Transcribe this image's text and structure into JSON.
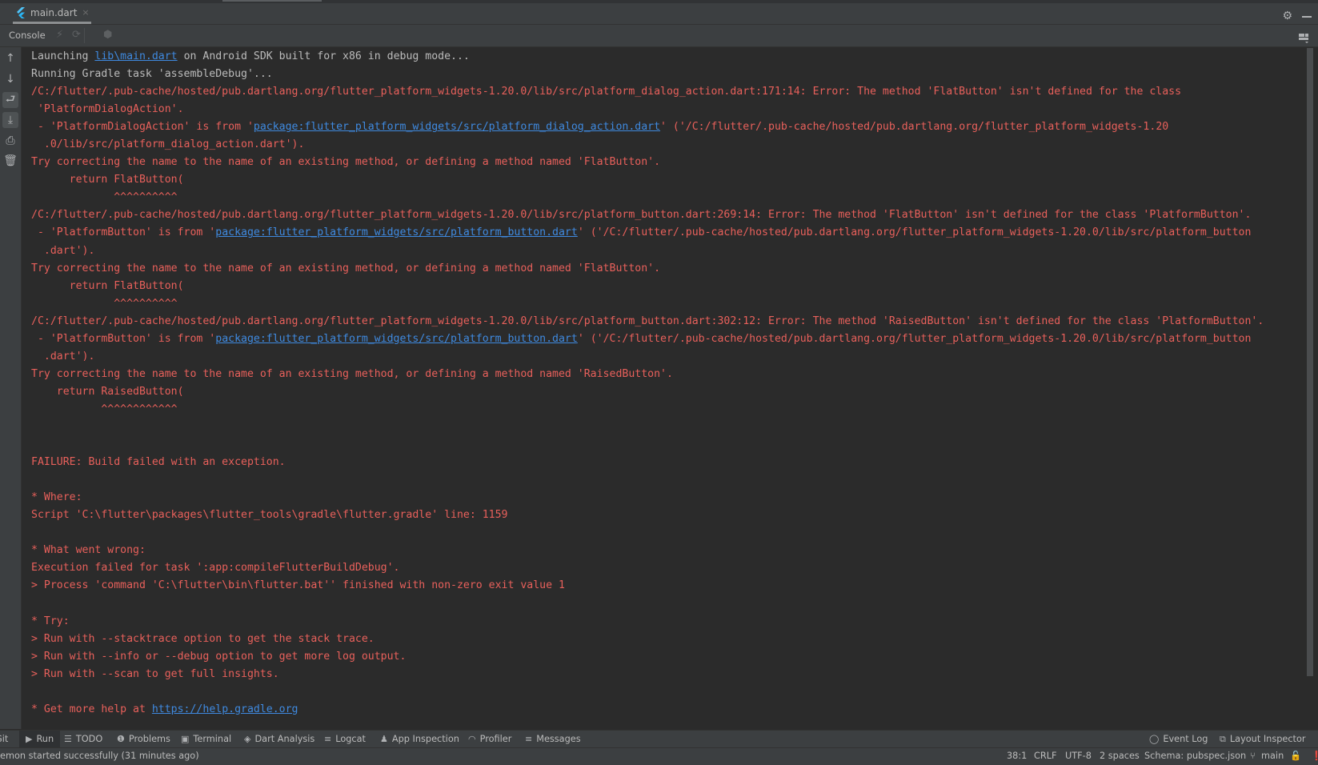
{
  "editor_tab": {
    "label": "main.dart",
    "close": "×",
    "icon": "flutter-icon"
  },
  "toolbar": {
    "console_label": "Console"
  },
  "console": {
    "colors": {
      "info": "#bbbbbb",
      "error": "#e8605b",
      "link": "#3f8ae0"
    },
    "lines": [
      {
        "type": "info",
        "segments": [
          {
            "text": "Launching "
          },
          {
            "text": "lib\\main.dart",
            "link": true
          },
          {
            "text": " on Android SDK built for x86 in debug mode..."
          }
        ]
      },
      {
        "type": "info",
        "segments": [
          {
            "text": "Running Gradle task 'assembleDebug'..."
          }
        ]
      },
      {
        "type": "error",
        "segments": [
          {
            "text": "/C:/flutter/.pub-cache/hosted/pub.dartlang.org/flutter_platform_widgets-1.20.0/lib/src/platform_dialog_action.dart:171:14: Error: The method 'FlatButton' isn't defined for the class"
          }
        ]
      },
      {
        "type": "error",
        "segments": [
          {
            "text": " 'PlatformDialogAction'."
          }
        ]
      },
      {
        "type": "error",
        "segments": [
          {
            "text": " - 'PlatformDialogAction' is from '"
          },
          {
            "text": "package:flutter_platform_widgets/src/platform_dialog_action.dart",
            "link": true
          },
          {
            "text": "' ('/C:/flutter/.pub-cache/hosted/pub.dartlang.org/flutter_platform_widgets-1.20"
          }
        ]
      },
      {
        "type": "error",
        "segments": [
          {
            "text": "  .0/lib/src/platform_dialog_action.dart')."
          }
        ]
      },
      {
        "type": "error",
        "segments": [
          {
            "text": "Try correcting the name to the name of an existing method, or defining a method named 'FlatButton'."
          }
        ]
      },
      {
        "type": "error",
        "segments": [
          {
            "text": "      return FlatButton("
          }
        ]
      },
      {
        "type": "error",
        "segments": [
          {
            "text": "             ^^^^^^^^^^"
          }
        ]
      },
      {
        "type": "error",
        "segments": [
          {
            "text": "/C:/flutter/.pub-cache/hosted/pub.dartlang.org/flutter_platform_widgets-1.20.0/lib/src/platform_button.dart:269:14: Error: The method 'FlatButton' isn't defined for the class 'PlatformButton'."
          }
        ]
      },
      {
        "type": "error",
        "segments": [
          {
            "text": " - 'PlatformButton' is from '"
          },
          {
            "text": "package:flutter_platform_widgets/src/platform_button.dart",
            "link": true
          },
          {
            "text": "' ('/C:/flutter/.pub-cache/hosted/pub.dartlang.org/flutter_platform_widgets-1.20.0/lib/src/platform_button"
          }
        ]
      },
      {
        "type": "error",
        "segments": [
          {
            "text": "  .dart')."
          }
        ]
      },
      {
        "type": "error",
        "segments": [
          {
            "text": "Try correcting the name to the name of an existing method, or defining a method named 'FlatButton'."
          }
        ]
      },
      {
        "type": "error",
        "segments": [
          {
            "text": "      return FlatButton("
          }
        ]
      },
      {
        "type": "error",
        "segments": [
          {
            "text": "             ^^^^^^^^^^"
          }
        ]
      },
      {
        "type": "error",
        "segments": [
          {
            "text": "/C:/flutter/.pub-cache/hosted/pub.dartlang.org/flutter_platform_widgets-1.20.0/lib/src/platform_button.dart:302:12: Error: The method 'RaisedButton' isn't defined for the class 'PlatformButton'."
          }
        ]
      },
      {
        "type": "error",
        "segments": [
          {
            "text": " - 'PlatformButton' is from '"
          },
          {
            "text": "package:flutter_platform_widgets/src/platform_button.dart",
            "link": true
          },
          {
            "text": "' ('/C:/flutter/.pub-cache/hosted/pub.dartlang.org/flutter_platform_widgets-1.20.0/lib/src/platform_button"
          }
        ]
      },
      {
        "type": "error",
        "segments": [
          {
            "text": "  .dart')."
          }
        ]
      },
      {
        "type": "error",
        "segments": [
          {
            "text": "Try correcting the name to the name of an existing method, or defining a method named 'RaisedButton'."
          }
        ]
      },
      {
        "type": "error",
        "segments": [
          {
            "text": "    return RaisedButton("
          }
        ]
      },
      {
        "type": "error",
        "segments": [
          {
            "text": "           ^^^^^^^^^^^^"
          }
        ]
      },
      {
        "type": "error",
        "segments": [
          {
            "text": ""
          }
        ]
      },
      {
        "type": "error",
        "segments": [
          {
            "text": ""
          }
        ]
      },
      {
        "type": "error",
        "segments": [
          {
            "text": "FAILURE: Build failed with an exception."
          }
        ]
      },
      {
        "type": "error",
        "segments": [
          {
            "text": ""
          }
        ]
      },
      {
        "type": "error",
        "segments": [
          {
            "text": "* Where:"
          }
        ]
      },
      {
        "type": "error",
        "segments": [
          {
            "text": "Script 'C:\\flutter\\packages\\flutter_tools\\gradle\\flutter.gradle' line: 1159"
          }
        ]
      },
      {
        "type": "error",
        "segments": [
          {
            "text": ""
          }
        ]
      },
      {
        "type": "error",
        "segments": [
          {
            "text": "* What went wrong:"
          }
        ]
      },
      {
        "type": "error",
        "segments": [
          {
            "text": "Execution failed for task ':app:compileFlutterBuildDebug'."
          }
        ]
      },
      {
        "type": "error",
        "segments": [
          {
            "text": "> Process 'command 'C:\\flutter\\bin\\flutter.bat'' finished with non-zero exit value 1"
          }
        ]
      },
      {
        "type": "error",
        "segments": [
          {
            "text": ""
          }
        ]
      },
      {
        "type": "error",
        "segments": [
          {
            "text": "* Try:"
          }
        ]
      },
      {
        "type": "error",
        "segments": [
          {
            "text": "> Run with --stacktrace option to get the stack trace."
          }
        ]
      },
      {
        "type": "error",
        "segments": [
          {
            "text": "> Run with --info or --debug option to get more log output."
          }
        ]
      },
      {
        "type": "error",
        "segments": [
          {
            "text": "> Run with --scan to get full insights."
          }
        ]
      },
      {
        "type": "error",
        "segments": [
          {
            "text": ""
          }
        ]
      },
      {
        "type": "error",
        "segments": [
          {
            "text": "* Get more help at "
          },
          {
            "text": "https://help.gradle.org",
            "link": true
          }
        ]
      }
    ]
  },
  "bottom_tools": {
    "left": [
      {
        "label": "Git",
        "icon": ""
      },
      {
        "label": "Run",
        "icon": "play-icon",
        "active": true
      },
      {
        "label": "TODO",
        "icon": "list-icon"
      },
      {
        "label": "Problems",
        "icon": "problems-icon"
      },
      {
        "label": "Terminal",
        "icon": "terminal-icon"
      },
      {
        "label": "Dart Analysis",
        "icon": "dart-icon"
      },
      {
        "label": "Logcat",
        "icon": "logcat-icon"
      },
      {
        "label": "App Inspection",
        "icon": "inspection-icon"
      },
      {
        "label": "Profiler",
        "icon": "profiler-icon"
      },
      {
        "label": "Messages",
        "icon": "messages-icon"
      }
    ],
    "right": [
      {
        "label": "Event Log",
        "icon": "event-log-icon"
      },
      {
        "label": "Layout Inspector",
        "icon": "layout-inspector-icon"
      }
    ]
  },
  "status": {
    "message": "emon started successfully (31 minutes ago)",
    "position": "38:1",
    "line_separator": "CRLF",
    "encoding": "UTF-8",
    "indent": "2 spaces",
    "schema": "Schema: pubspec.json",
    "branch": "main"
  }
}
